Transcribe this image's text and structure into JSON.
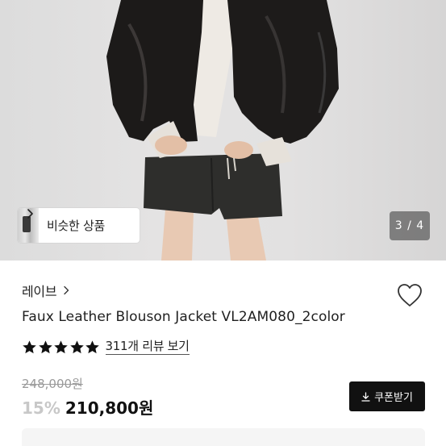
{
  "product_image": {
    "alt": "product photo",
    "similar_button": {
      "label": "비슷한 상품"
    },
    "counter": {
      "current": "3",
      "total": "4",
      "text": "3 / 4"
    }
  },
  "brand": {
    "name": "레이브"
  },
  "product": {
    "title": "Faux Leather Blouson Jacket VL2AM080_2color",
    "rating_stars": 5,
    "review_link": "311개 리뷰 보기"
  },
  "price": {
    "original": "248,000원",
    "discount": "15%",
    "final": "210,800원"
  },
  "coupon": {
    "label": "쿠폰받기"
  },
  "colors": {
    "button_dark": "#111111",
    "discount_text": "#c8c8c8",
    "counter_bg": "#5a5a5a"
  },
  "icons": {
    "heart": "heart-outline-icon",
    "star": "star-icon",
    "chevron": "chevron-right-icon",
    "download": "download-icon"
  }
}
